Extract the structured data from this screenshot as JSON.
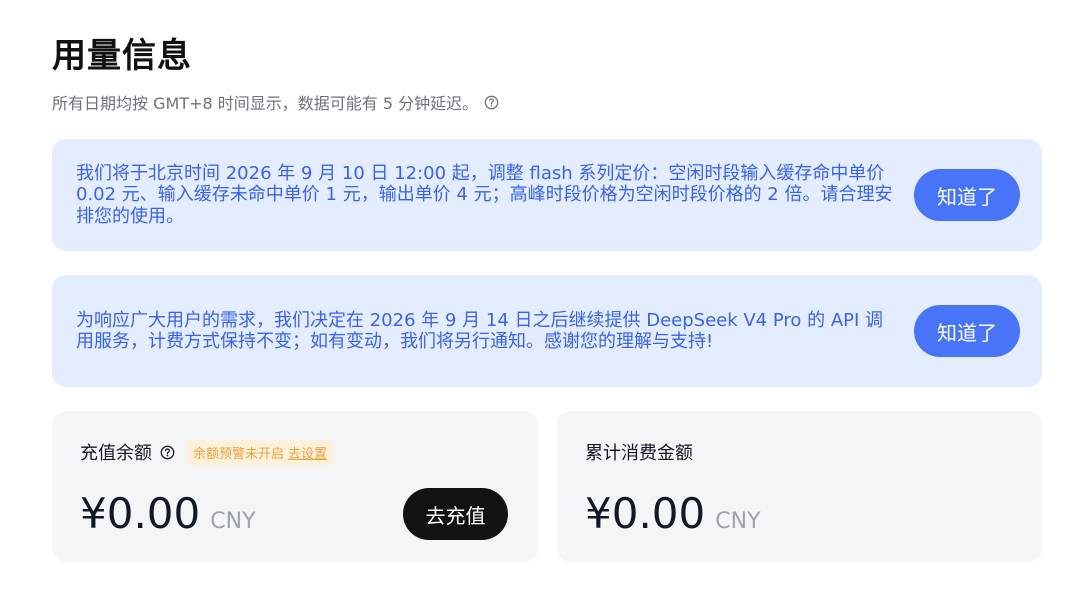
{
  "page": {
    "title": "用量信息",
    "subtitle": "所有日期均按 GMT+8 时间显示，数据可能有 5 分钟延迟。"
  },
  "notices": [
    {
      "text": "我们将于北京时间 2026 年 9 月 10 日 12:00 起，调整 flash 系列定价：空闲时段输入缓存命中单价 0.02 元、输入缓存未命中单价 1 元，输出单价 4 元；高峰时段价格为空闲时段价格的 2 倍。请合理安排您的使用。",
      "button_label": "知道了"
    },
    {
      "text": "为响应广大用户的需求，我们决定在 2026 年 9 月 14 日之后继续提供 DeepSeek V4 Pro 的 API 调用服务，计费方式保持不变；如有变动，我们将另行通知。感谢您的理解与支持!",
      "button_label": "知道了"
    }
  ],
  "balance_card": {
    "label": "充值余额",
    "warning_text": "余额预警未开启",
    "warning_link": "去设置",
    "amount": "¥0.00",
    "currency": "CNY",
    "button_label": "去充值"
  },
  "spend_card": {
    "label": "累计消费金额",
    "amount": "¥0.00",
    "currency": "CNY"
  },
  "colors": {
    "notice_bg": "#e3edff",
    "notice_text": "#3a62e8",
    "primary_button": "#4874f7",
    "dark_button": "#111214",
    "warning_text": "#e6a23c",
    "card_bg": "#f4f5f7"
  },
  "icons": {
    "subtitle_help": "help-circle-icon",
    "balance_help": "help-circle-icon"
  }
}
